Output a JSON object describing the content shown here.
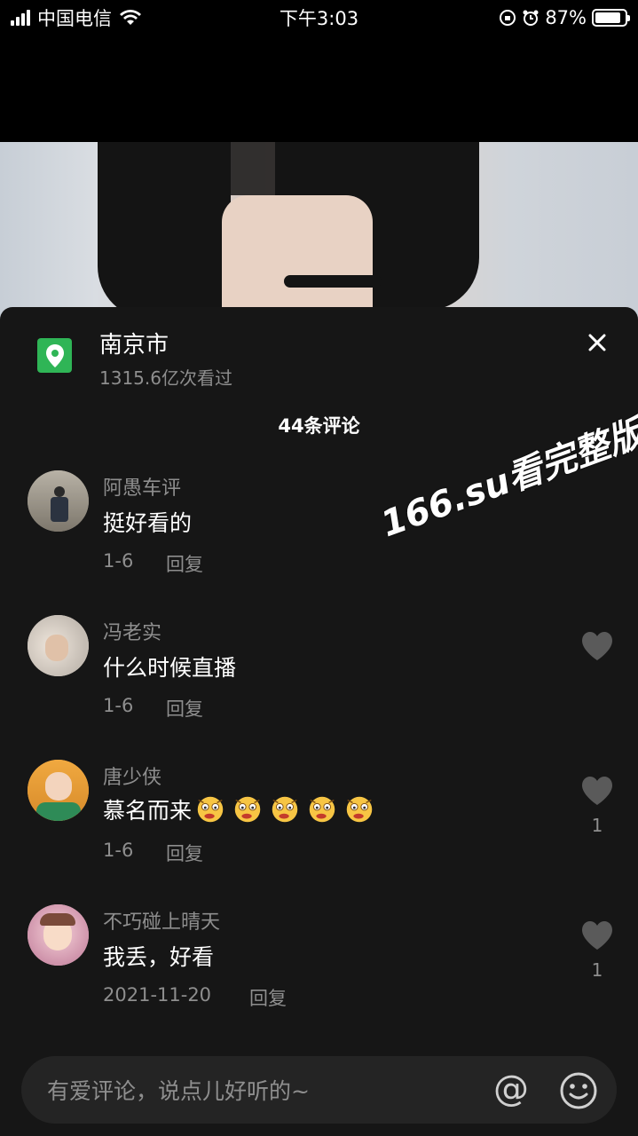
{
  "status_bar": {
    "carrier": "中国电信",
    "time": "下午3:03",
    "battery": "87%",
    "battery_level": 0.87
  },
  "location": {
    "title": "南京市",
    "views": "1315.6亿次看过"
  },
  "comments_count": "44条评论",
  "watermark": "166.su看完整版",
  "comments": [
    {
      "name": "阿愚车评",
      "text": "挺好看的",
      "date": "1-6",
      "reply": "回复",
      "likes": ""
    },
    {
      "name": "冯老实",
      "text": "什么时候直播",
      "date": "1-6",
      "reply": "回复",
      "likes": ""
    },
    {
      "name": "唐少侠",
      "text": "慕名而来",
      "date": "1-6",
      "reply": "回复",
      "likes": "1"
    },
    {
      "name": "不巧碰上晴天",
      "text": "我丢，好看",
      "date": "2021-11-20",
      "reply": "回复",
      "likes": "1"
    }
  ],
  "input": {
    "placeholder": "有爱评论，说点儿好听的~",
    "at_symbol": "@"
  },
  "colors": {
    "sheet_bg": "#161616",
    "muted_text": "#8e8e8e",
    "location_green": "#2fb556"
  }
}
